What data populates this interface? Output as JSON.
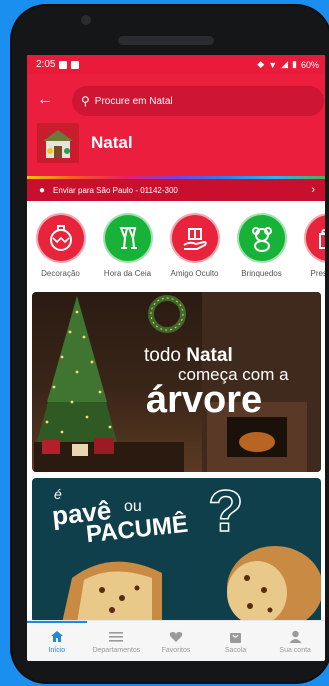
{
  "status": {
    "time": "2:05",
    "battery": "60%"
  },
  "search": {
    "placeholder": "Procure em Natal"
  },
  "category": {
    "title": "Natal"
  },
  "address": {
    "label": "Enviar para São Paulo - 01142-300"
  },
  "categories": [
    {
      "label": "Decoração",
      "color": "#e8243c",
      "icon": "ornament-icon"
    },
    {
      "label": "Hora da Ceia",
      "color": "#19b239",
      "icon": "champagne-icon"
    },
    {
      "label": "Amigo Oculto",
      "color": "#e8243c",
      "icon": "gift-hand-icon"
    },
    {
      "label": "Brinquedos",
      "color": "#19b239",
      "icon": "teddy-bear-icon"
    },
    {
      "label": "Presentes",
      "color": "#e8243c",
      "icon": "gift-icon"
    }
  ],
  "banner1": {
    "line1a": "todo ",
    "line1b": "Natal",
    "line2": "começa com a",
    "line3": "árvore"
  },
  "banner2": {
    "line1": "é",
    "line2": "pavê",
    "line3": "ou",
    "line4": "PACUMÊ",
    "mark": "?"
  },
  "tabs": [
    {
      "label": "Início",
      "icon": "home-icon"
    },
    {
      "label": "Departamentos",
      "icon": "menu-icon"
    },
    {
      "label": "Favoritos",
      "icon": "heart-icon"
    },
    {
      "label": "Sacola",
      "icon": "bag-icon"
    },
    {
      "label": "Sua conta",
      "icon": "user-icon"
    }
  ],
  "colors": {
    "brand": "#ec1e3e",
    "green": "#19b239",
    "tab_active": "#1e88e5"
  }
}
